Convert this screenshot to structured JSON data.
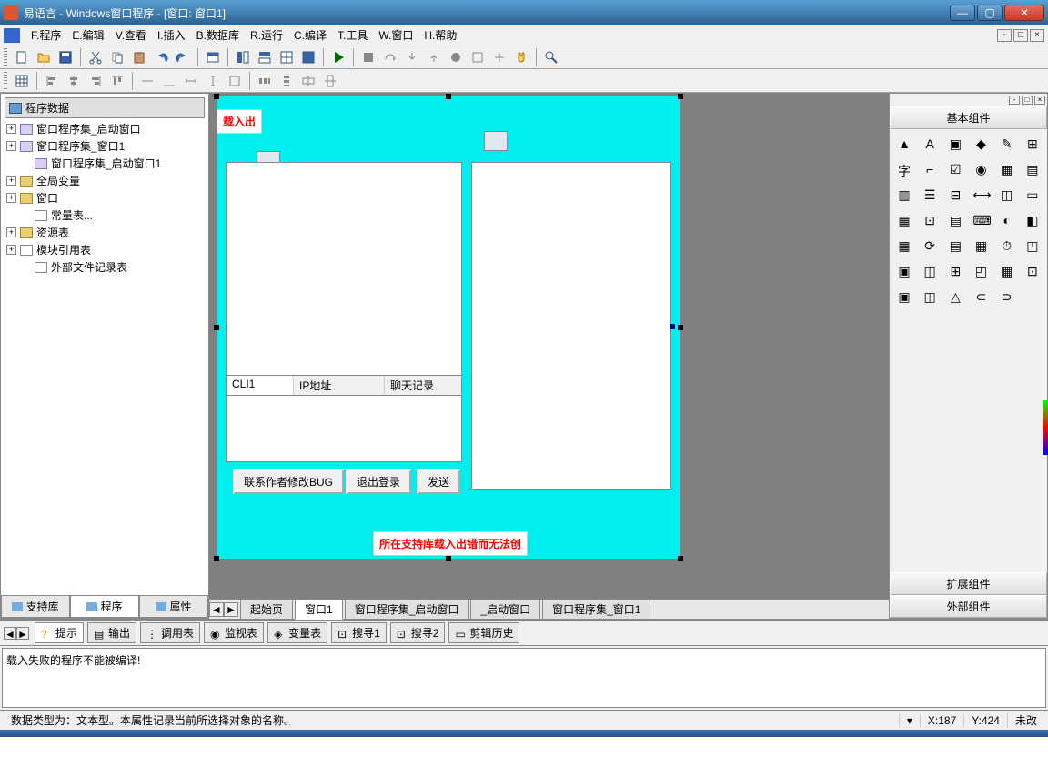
{
  "titlebar": {
    "text": "易语言 - Windows窗口程序 - [窗口: 窗口1]"
  },
  "menus": [
    "F.程序",
    "E.编辑",
    "V.查看",
    "I.插入",
    "B.数据库",
    "R.运行",
    "C.编译",
    "T.工具",
    "W.窗口",
    "H.帮助"
  ],
  "tree": {
    "header": "程序数据",
    "nodes": [
      {
        "exp": "+",
        "icon": "code",
        "label": "窗口程序集_启动窗口"
      },
      {
        "exp": "+",
        "icon": "code",
        "label": "窗口程序集_窗口1"
      },
      {
        "exp": "",
        "icon": "code",
        "label": "窗口程序集_启动窗口1",
        "indent": 1
      },
      {
        "exp": "+",
        "icon": "folder",
        "label": "全局变量"
      },
      {
        "exp": "+",
        "icon": "folder",
        "label": "窗口"
      },
      {
        "exp": "",
        "icon": "doc",
        "label": "常量表...",
        "indent": 1
      },
      {
        "exp": "+",
        "icon": "folder",
        "label": "资源表"
      },
      {
        "exp": "+",
        "icon": "doc",
        "label": "模块引用表"
      },
      {
        "exp": "",
        "icon": "doc",
        "label": "外部文件记录表",
        "indent": 1
      }
    ]
  },
  "left_tabs": [
    "支持库",
    "程序",
    "属性"
  ],
  "design": {
    "label_top": "载入出",
    "col1": "CLI1",
    "col2": "IP地址",
    "col3": "聊天记录",
    "btn1": "联系作者修改BUG",
    "btn2": "退出登录",
    "btn3": "发送",
    "error_label": "所在支持库载入出错而无法创"
  },
  "bottom_tabs": [
    "起始页",
    "窗口1",
    "窗口程序集_启动窗口",
    "_启动窗口",
    "窗口程序集_窗口1"
  ],
  "palette": {
    "header": "基本组件",
    "footer1": "扩展组件",
    "footer2": "外部组件"
  },
  "output_tabs": [
    "提示",
    "输出",
    "调用表",
    "监视表",
    "变量表",
    "搜寻1",
    "搜寻2",
    "剪辑历史"
  ],
  "output_text": "载入失败的程序不能被编译!",
  "statusbar": {
    "left": "数据类型为：文本型。本属性记录当前所选择对象的名称。",
    "coords_x": "X:187",
    "coords_y": "Y:424",
    "mod": "未改"
  }
}
